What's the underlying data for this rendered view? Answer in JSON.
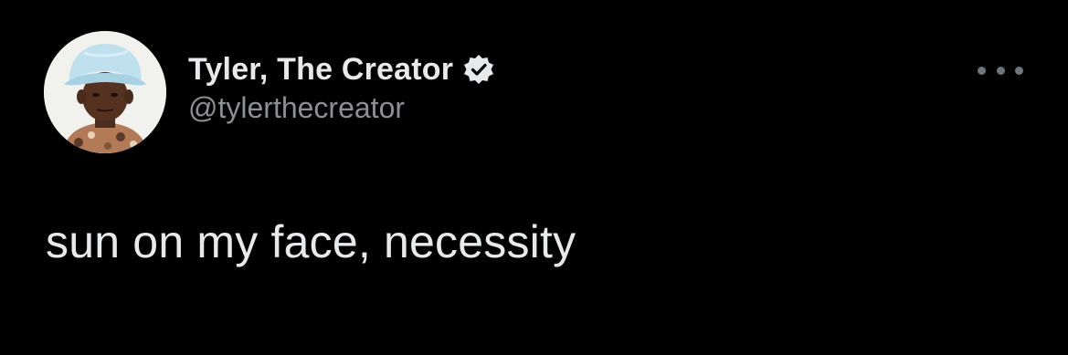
{
  "tweet": {
    "author": {
      "display_name": "Tyler, The Creator",
      "handle": "@tylerthecreator",
      "verified": true,
      "avatar": "profile-photo",
      "verified_icon": "verified-badge-icon"
    },
    "more_icon": "more-horizontal-icon",
    "text": "sun on my face, necessity",
    "colors": {
      "background": "#000000",
      "text": "#e7e9ea",
      "secondary": "#8b9095",
      "link": "#1d6fa3"
    }
  }
}
